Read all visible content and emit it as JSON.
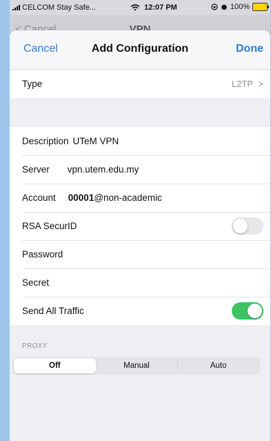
{
  "status_bar": {
    "carrier": "CELCOM Stay Safe...",
    "time": "12:07 PM",
    "battery": "100%"
  },
  "parent": {
    "back_label": "< Cancel",
    "title": "VPN"
  },
  "nav": {
    "cancel": "Cancel",
    "title": "Add Configuration",
    "done": "Done"
  },
  "type_row": {
    "label": "Type",
    "value": "L2TP",
    "chevron": ">"
  },
  "fields": {
    "description": {
      "label": "Description",
      "value": "UTeM VPN"
    },
    "server": {
      "label": "Server",
      "value": "vpn.utem.edu.my"
    },
    "account": {
      "label": "Account",
      "value_bold": "00001",
      "value_rest": "@non-academic"
    },
    "rsa": {
      "label": "RSA SecurID",
      "on": false
    },
    "password": {
      "label": "Password"
    },
    "secret": {
      "label": "Secret"
    },
    "send_all": {
      "label": "Send All Traffic",
      "on": true
    }
  },
  "proxy": {
    "header": "PROXY",
    "options": [
      "Off",
      "Manual",
      "Auto"
    ],
    "selected": "Off"
  },
  "colors": {
    "accent": "#2f7cd6",
    "toggle_on": "#3cc462",
    "battery": "#ffd60a"
  }
}
